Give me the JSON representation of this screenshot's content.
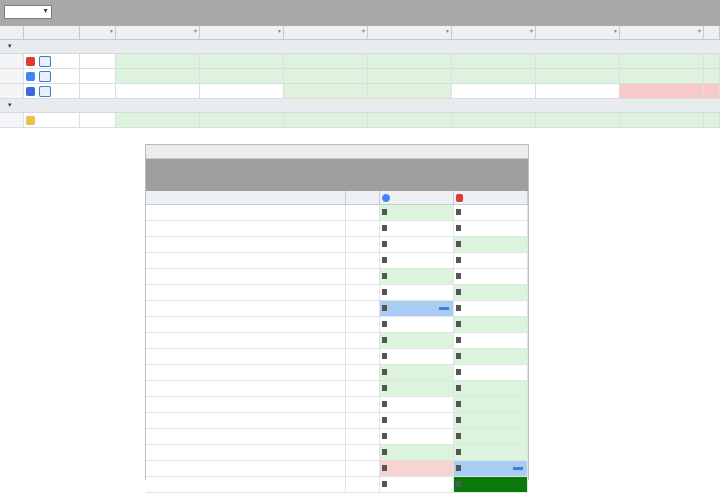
{
  "toolbar": {
    "period_select_value": "",
    "caret_icon": "chevron-down-icon",
    "background": "#a9a9a9"
  },
  "grid": {
    "columns": [
      "",
      "",
      "",
      "",
      "",
      "",
      "",
      "",
      "",
      "",
      ""
    ],
    "groups": [
      {
        "label": "",
        "rows": [
          {
            "engine_icon": "yandex-logo-icon",
            "engine": "",
            "value": "",
            "cells": [
              "",
              "",
              "",
              "",
              "",
              "",
              "",
              ""
            ],
            "states": [
              "green",
              "green",
              "green",
              "green",
              "green",
              "green",
              "green",
              "green"
            ]
          },
          {
            "engine_icon": "google-logo-icon",
            "engine": "",
            "value": "",
            "cells": [
              "",
              "",
              "",
              "",
              "",
              "",
              "",
              ""
            ],
            "states": [
              "green",
              "green",
              "green",
              "green",
              "green",
              "green",
              "green",
              "green"
            ]
          },
          {
            "engine_icon": "rambler-logo-icon",
            "engine": "",
            "value": "",
            "cells": [
              "",
              "",
              "",
              "",
              "",
              "",
              "",
              ""
            ],
            "states": [
              "white",
              "white",
              "green",
              "green",
              "white",
              "white",
              "red",
              "red"
            ]
          }
        ]
      },
      {
        "label": "",
        "rows": [
          {
            "engine_icon": "folder-icon",
            "engine": "",
            "value": "",
            "cells": [
              "",
              "",
              "",
              "",
              "",
              "",
              "",
              ""
            ],
            "states": [
              "green",
              "green",
              "green",
              "green",
              "green",
              "green",
              "green",
              "green"
            ]
          }
        ]
      }
    ],
    "colors": {
      "positive": "#ddf3dd",
      "negative": "#f7c9c9"
    }
  },
  "panel": {
    "title": "",
    "banner": "",
    "headers": {
      "phrase": "",
      "num": "",
      "yandex": "",
      "google": ""
    },
    "rows": [
      {
        "phrase": "",
        "num": "",
        "ya": "",
        "g": "",
        "ya_bg": "white",
        "g_bg": "green"
      },
      {
        "phrase": "",
        "num": "",
        "ya": "",
        "g": "",
        "ya_bg": "white",
        "g_bg": "white"
      },
      {
        "phrase": "",
        "num": "",
        "ya": "",
        "g": "",
        "ya_bg": "green",
        "g_bg": "white"
      },
      {
        "phrase": "",
        "num": "",
        "ya": "",
        "g": "",
        "ya_bg": "white",
        "g_bg": "white"
      },
      {
        "phrase": "",
        "num": "",
        "ya": "",
        "g": "",
        "ya_bg": "white",
        "g_bg": "green"
      },
      {
        "phrase": "",
        "num": "",
        "ya": "",
        "g": "",
        "ya_bg": "green",
        "g_bg": "white"
      },
      {
        "phrase": "",
        "num": "",
        "ya": "",
        "g": "",
        "ya_bg": "white",
        "g_bg": "blue"
      },
      {
        "phrase": "",
        "num": "",
        "ya": "",
        "g": "",
        "ya_bg": "green",
        "g_bg": "white"
      },
      {
        "phrase": "",
        "num": "",
        "ya": "",
        "g": "",
        "ya_bg": "white",
        "g_bg": "green"
      },
      {
        "phrase": "",
        "num": "",
        "ya": "",
        "g": "",
        "ya_bg": "green",
        "g_bg": "white"
      },
      {
        "phrase": "",
        "num": "",
        "ya": "",
        "g": "",
        "ya_bg": "white",
        "g_bg": "green"
      },
      {
        "phrase": "",
        "num": "",
        "ya": "",
        "g": "",
        "ya_bg": "green",
        "g_bg": "green"
      },
      {
        "phrase": "",
        "num": "",
        "ya": "",
        "g": "",
        "ya_bg": "green",
        "g_bg": "white"
      },
      {
        "phrase": "",
        "num": "",
        "ya": "",
        "g": "",
        "ya_bg": "green",
        "g_bg": "white"
      },
      {
        "phrase": "",
        "num": "",
        "ya": "",
        "g": "",
        "ya_bg": "green",
        "g_bg": "white"
      },
      {
        "phrase": "",
        "num": "",
        "ya": "",
        "g": "",
        "ya_bg": "green",
        "g_bg": "green"
      },
      {
        "phrase": "",
        "num": "",
        "ya": "",
        "g": "",
        "ya_bg": "blue",
        "g_bg": "pink"
      },
      {
        "phrase": "",
        "num": "",
        "ya": "",
        "g": "",
        "ya_bg": "dark",
        "g_bg": "white"
      }
    ],
    "colors": {
      "highlight_blue": "#a9cdf2",
      "top_green": "#0b7a0b",
      "drop_pink": "#f7d3d3"
    }
  }
}
